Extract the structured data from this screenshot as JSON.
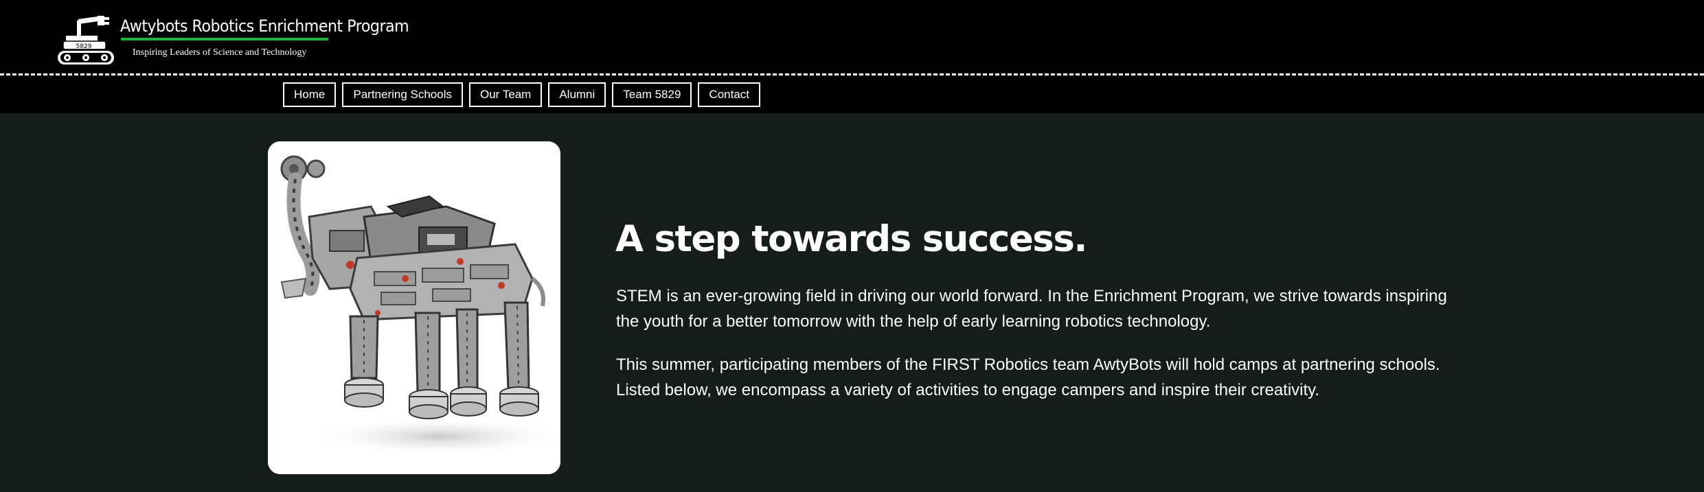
{
  "header": {
    "site_title": "Awtybots Robotics Enrichment Program",
    "tagline": "Inspiring Leaders of Science and Technology",
    "logo_badge": "5829",
    "accent_color": "#22b535"
  },
  "nav": {
    "items": [
      {
        "label": "Home"
      },
      {
        "label": "Partnering Schools"
      },
      {
        "label": "Our Team"
      },
      {
        "label": "Alumni"
      },
      {
        "label": "Team 5829"
      },
      {
        "label": "Contact"
      }
    ]
  },
  "hero": {
    "heading": "A step towards success.",
    "paragraphs": [
      "STEM is an ever-growing field in driving our world forward. In the Enrichment Program, we strive towards inspiring the youth for a better tomorrow with the help of early learning robotics technology.",
      "This summer, participating members of the FIRST Robotics team AwtyBots will hold camps at partnering schools. Listed below, we encompass a variety of activities to engage campers and inspire their creativity."
    ],
    "image_icon": "robot-elephant-image"
  },
  "colors": {
    "header_bg": "#000000",
    "page_bg": "#161c19",
    "text": "#ffffff"
  }
}
